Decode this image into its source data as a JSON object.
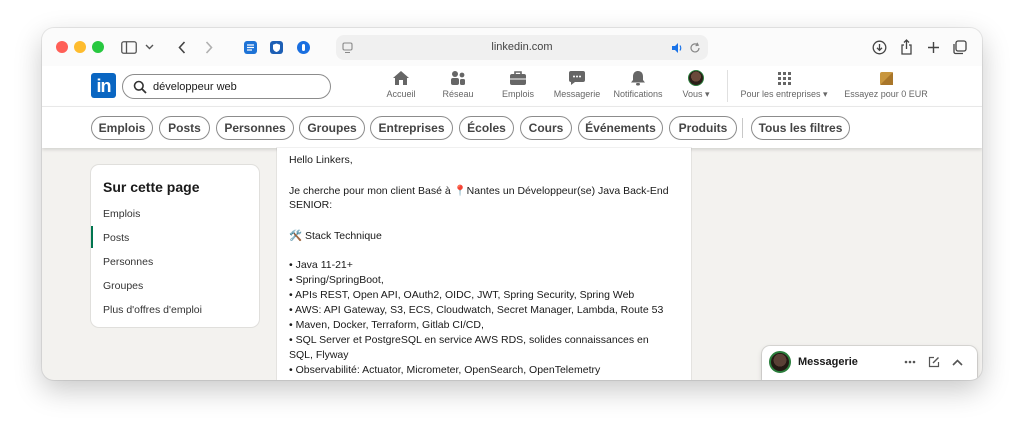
{
  "browser": {
    "url": "linkedin.com"
  },
  "search": {
    "value": "développeur web"
  },
  "nav": {
    "items": [
      {
        "label": "Accueil"
      },
      {
        "label": "Réseau"
      },
      {
        "label": "Emplois"
      },
      {
        "label": "Messagerie"
      },
      {
        "label": "Notifications"
      },
      {
        "label": "Vous ▾"
      },
      {
        "label": "Pour les entreprises ▾"
      },
      {
        "label": "Essayez pour 0 EUR"
      }
    ]
  },
  "filters": {
    "pills": [
      "Emplois",
      "Posts",
      "Personnes",
      "Groupes",
      "Entreprises",
      "Écoles",
      "Cours",
      "Événements",
      "Produits"
    ],
    "all_filters": "Tous les filtres"
  },
  "sidebar": {
    "title": "Sur cette page",
    "items": [
      {
        "label": "Emplois"
      },
      {
        "label": "Posts"
      },
      {
        "label": "Personnes"
      },
      {
        "label": "Groupes"
      },
      {
        "label": "Plus d'offres d'emploi"
      }
    ]
  },
  "post": {
    "lines": [
      "Hello Linkers,",
      "Je cherche pour mon client Basé à 📍Nantes un Développeur(se) Java Back-End",
      "SENIOR:",
      "🛠️ Stack Technique",
      "• Java 11-21+",
      "• Spring/SpringBoot,",
      "• APIs REST, Open API, OAuth2, OIDC, JWT, Spring Security, Spring Web",
      "• AWS: API Gateway, S3, ECS, Cloudwatch, Secret Manager, Lambda, Route 53",
      "• Maven, Docker, Terraform, Gitlab CI/CD,",
      "• SQL Server et PostgreSQL en service AWS RDS, solides connaissances en",
      "SQL, Flyway",
      "• Observabilité: Actuator, Micrometer, OpenSearch, OpenTelemetry"
    ]
  },
  "messaging": {
    "title": "Messagerie"
  },
  "colors": {
    "linkedin_blue": "#0a66c2",
    "active_green": "#01754f"
  }
}
